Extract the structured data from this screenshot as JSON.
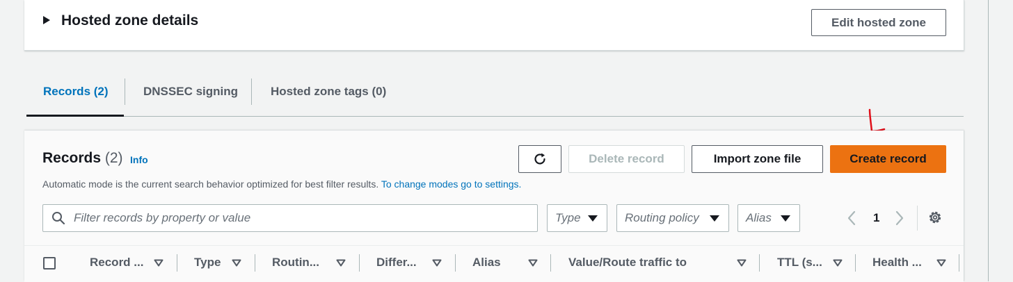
{
  "hosted_zone": {
    "title": "Hosted zone details",
    "edit_label": "Edit hosted zone"
  },
  "tabs": [
    {
      "label": "Records (2)",
      "active": true
    },
    {
      "label": "DNSSEC signing",
      "active": false
    },
    {
      "label": "Hosted zone tags (0)",
      "active": false
    }
  ],
  "records": {
    "title": "Records",
    "count": "(2)",
    "info": "Info",
    "description": "Automatic mode is the current search behavior optimized for best filter results.",
    "settings_link": "To change modes go to settings.",
    "buttons": {
      "refresh_icon": "refresh-icon",
      "delete": "Delete record",
      "import": "Import zone file",
      "create": "Create record"
    },
    "search_placeholder": "Filter records by property or value",
    "filters": {
      "type": "Type",
      "routing_policy": "Routing policy",
      "alias": "Alias"
    },
    "page": "1"
  },
  "table": {
    "columns": [
      "Record ...",
      "Type",
      "Routin...",
      "Differ...",
      "Alias",
      "Value/Route traffic to",
      "TTL (s...",
      "Health ..."
    ]
  },
  "colors": {
    "primary": "#ec7211",
    "link": "#0073bb",
    "annotation": "#e0101a"
  }
}
